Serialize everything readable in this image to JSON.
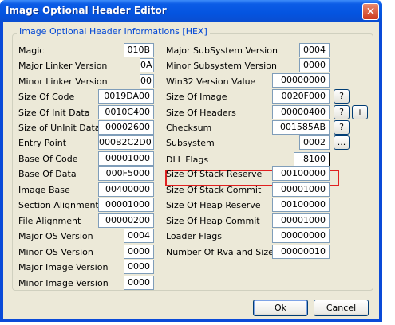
{
  "window": {
    "title": "Image Optional Header Editor",
    "close_glyph": "✕"
  },
  "group": {
    "title": "Image Optional Header Informations [HEX]"
  },
  "left_fields": [
    {
      "label": "Magic",
      "value": "010B"
    },
    {
      "label": "Major Linker Version",
      "value": "0A"
    },
    {
      "label": "Minor Linker Version",
      "value": "00"
    },
    {
      "label": "Size Of Code",
      "value": "0019DA00"
    },
    {
      "label": "Size Of Init Data",
      "value": "0010C400"
    },
    {
      "label": "Size of UnInit Data",
      "value": "00002600"
    },
    {
      "label": "Entry Point",
      "value": "000B2C2D0"
    },
    {
      "label": "Base Of Code",
      "value": "00001000"
    },
    {
      "label": "Base Of Data",
      "value": "000F5000"
    },
    {
      "label": "Image Base",
      "value": "00400000"
    },
    {
      "label": "Section Alignment",
      "value": "00001000"
    },
    {
      "label": "File Alignment",
      "value": "00000200"
    },
    {
      "label": "Major OS Version",
      "value": "0004"
    },
    {
      "label": "Minor OS Version",
      "value": "0000"
    },
    {
      "label": "Major Image Version",
      "value": "0000"
    },
    {
      "label": "Minor Image Version",
      "value": "0000"
    }
  ],
  "right_fields": [
    {
      "label": "Major SubSystem Version",
      "value": "0004"
    },
    {
      "label": "Minor Subsystem Version",
      "value": "0000"
    },
    {
      "label": "Win32 Version Value",
      "value": "00000000"
    },
    {
      "label": "Size Of Image",
      "value": "0020F000"
    },
    {
      "label": "Size Of Headers",
      "value": "00000400"
    },
    {
      "label": "Checksum",
      "value": "001585AB"
    },
    {
      "label": "Subsystem",
      "value": "0002"
    },
    {
      "label": "DLL Flags",
      "value": "8100"
    },
    {
      "label": "Size Of Stack Reserve",
      "value": "00100000"
    },
    {
      "label": "Size Of Stack Commit",
      "value": "00001000"
    },
    {
      "label": "Size Of Heap Reserve",
      "value": "00100000"
    },
    {
      "label": "Size Of Heap Commit",
      "value": "00001000"
    },
    {
      "label": "Loader Flags",
      "value": "00000000"
    },
    {
      "label": "Number Of Rva and Sizes",
      "value": "00000010"
    }
  ],
  "side_buttons": {
    "help": "?",
    "plus": "+",
    "browse": "..."
  },
  "buttons": {
    "ok": "Ok",
    "cancel": "Cancel"
  },
  "colors": {
    "title_bar": "#0454e0",
    "group_title": "#0046d5",
    "highlight": "#e02020"
  }
}
